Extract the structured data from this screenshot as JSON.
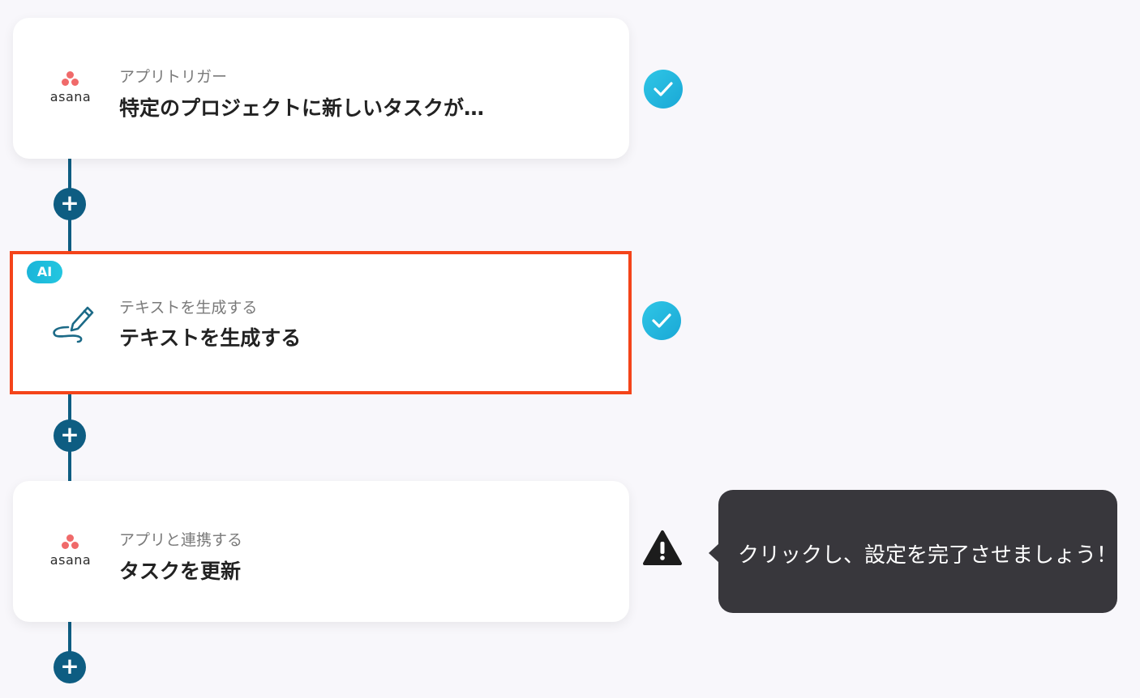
{
  "steps": [
    {
      "app_icon": "asana-logo",
      "app_name": "asana",
      "subtitle": "アプリトリガー",
      "title": "特定のプロジェクトに新しいタスクが…",
      "status": "complete"
    },
    {
      "badge": "AI",
      "app_icon": "pen-write-icon",
      "subtitle": "テキストを生成する",
      "title": "テキストを生成する",
      "status": "complete",
      "selected": true
    },
    {
      "app_icon": "asana-logo",
      "app_name": "asana",
      "subtitle": "アプリと連携する",
      "title": "タスクを更新",
      "status": "warning"
    }
  ],
  "add_button_label": "+",
  "tooltip": {
    "text": "クリックし、設定を完了させましょう！"
  },
  "colors": {
    "connector": "#0e5d82",
    "selected_border": "#f4441a",
    "check": "#1fb6df",
    "tooltip_bg": "#38373c",
    "asana": "#f06a6a"
  }
}
